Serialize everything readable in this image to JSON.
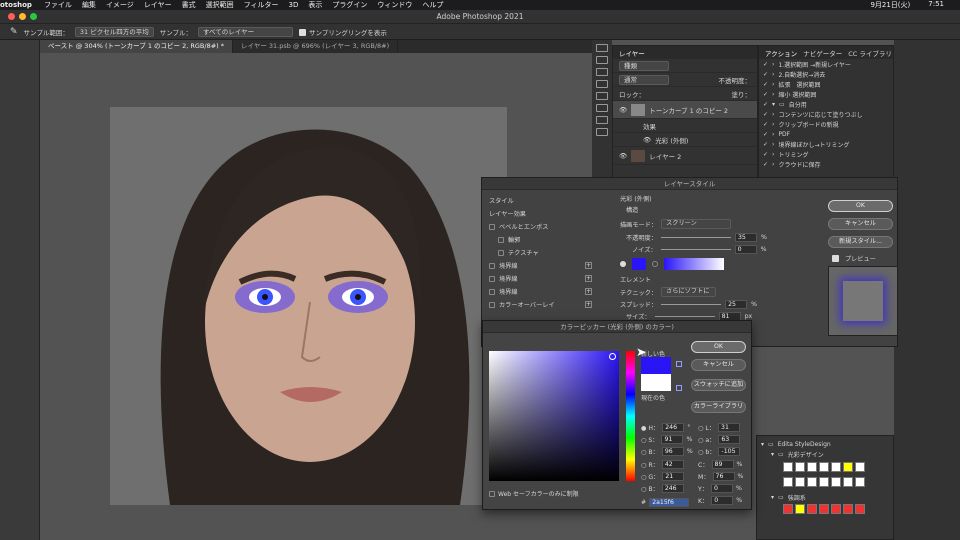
{
  "menubar": {
    "app": "otoshop",
    "items": [
      "ファイル",
      "編集",
      "イメージ",
      "レイヤー",
      "書式",
      "選択範囲",
      "フィルター",
      "3D",
      "表示",
      "プラグイン",
      "ウィンドウ",
      "ヘルプ"
    ],
    "date": "9月21日(火)",
    "time": "7:51"
  },
  "window": {
    "title": "Adobe Photoshop 2021"
  },
  "options": {
    "sample_size_label": "サンプル範囲：",
    "sample_size_value": "31 ピクセル四方の平均",
    "sample_label": "サンプル：",
    "sample_value": "すべてのレイヤー",
    "show_ring": "サンプリングリングを表示"
  },
  "tabs": [
    {
      "label": "ペースト @ 304% (トーンカーブ 1 のコピー 2, RGB/8#) *"
    },
    {
      "label": "レイヤー 31.psb @ 696% (レイヤー 3, RGB/8#)"
    }
  ],
  "layers_panel": {
    "tab": "レイヤー",
    "search_placeholder": "種類",
    "blend": "通常",
    "opacity": "不透明度：",
    "lock": "ロック：",
    "fill": "塗り：",
    "rows": [
      {
        "name": "トーンカーブ 1 のコピー 2"
      },
      {
        "name": "効果"
      },
      {
        "name": "光彩 (外側)"
      },
      {
        "name": "レイヤー 2"
      }
    ]
  },
  "actions_panel": {
    "tabs": [
      "アクション",
      "ナビゲーター",
      "CC ライブラリ"
    ],
    "items": [
      "1.選択範囲 →新規レイヤー",
      "2.自動選択→消去",
      "拡張　選択範囲",
      "縮小 選択範囲",
      "自分用",
      "コンテンツに応じて塗りつぶし",
      "クリップボードの新規",
      "PDF",
      "境界線ぼかし→トリミング",
      "トリミング",
      "クラウドに保存"
    ]
  },
  "layer_style": {
    "title": "レイヤースタイル",
    "styles_header": "スタイル",
    "effects_header": "レイヤー効果",
    "items": [
      "ベベルとエンボス",
      "輪郭",
      "テクスチャ",
      "境界線",
      "境界線",
      "境界線",
      "カラーオーバーレイ"
    ],
    "section": "光彩 (外側)",
    "structure": "構造",
    "blend_label": "描画モード：",
    "blend_value": "スクリーン",
    "opacity_label": "不透明度：",
    "opacity_value": "35",
    "noise_label": "ノイズ：",
    "noise_value": "0",
    "elements": "エレメント",
    "technique_label": "テクニック：",
    "technique_value": "さらにソフトに",
    "spread_label": "スプレッド：",
    "spread_value": "25",
    "size_label": "サイズ：",
    "size_value": "81",
    "pct": "%",
    "px": "px",
    "ok": "OK",
    "cancel": "キャンセル",
    "new_style": "新規スタイル...",
    "preview": "プレビュー"
  },
  "color_picker": {
    "title": "カラーピッカー (光彩 (外側) のカラー)",
    "new_label": "新しい色",
    "current_label": "現在の色",
    "ok": "OK",
    "cancel": "キャンセル",
    "add_swatch": "スウォッチに追加",
    "library": "カラーライブラリ",
    "H": "246",
    "S": "91",
    "B": "96",
    "R": "42",
    "G": "21",
    "Bv": "246",
    "L": "31",
    "a": "63",
    "b": "-105",
    "C": "89",
    "M": "76",
    "Y": "0",
    "K": "0",
    "hex": "2a15f6",
    "web_safe": "Web セーフカラーのみに制限",
    "new_color": "#2a15f6",
    "current_color": "#ffffff"
  },
  "swatches": {
    "group": "Edita StyleDesign",
    "sub1": "光彩デザイン",
    "sub2": "強調系"
  }
}
